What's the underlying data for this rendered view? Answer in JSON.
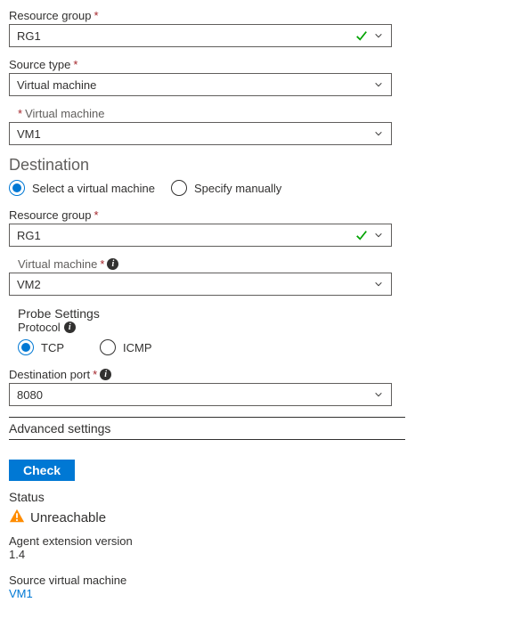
{
  "source": {
    "resourceGroup": {
      "label": "Resource group",
      "value": "RG1",
      "validated": true
    },
    "sourceType": {
      "label": "Source type",
      "value": "Virtual machine"
    },
    "virtualMachine": {
      "label": "Virtual machine",
      "value": "VM1"
    }
  },
  "destination": {
    "heading": "Destination",
    "mode": {
      "selectVm": "Select a virtual machine",
      "manual": "Specify manually",
      "selected": "selectVm"
    },
    "resourceGroup": {
      "label": "Resource group",
      "value": "RG1",
      "validated": true
    },
    "virtualMachine": {
      "label": "Virtual machine",
      "value": "VM2"
    }
  },
  "probe": {
    "heading": "Probe Settings",
    "protocolLabel": "Protocol",
    "protocols": {
      "tcp": "TCP",
      "icmp": "ICMP",
      "selected": "tcp"
    },
    "port": {
      "label": "Destination port",
      "value": "8080"
    }
  },
  "advancedLabel": "Advanced settings",
  "checkButton": "Check",
  "result": {
    "statusLabel": "Status",
    "statusValue": "Unreachable",
    "agentVersionLabel": "Agent extension version",
    "agentVersionValue": "1.4",
    "sourceVmLabel": "Source virtual machine",
    "sourceVmValue": "VM1"
  }
}
